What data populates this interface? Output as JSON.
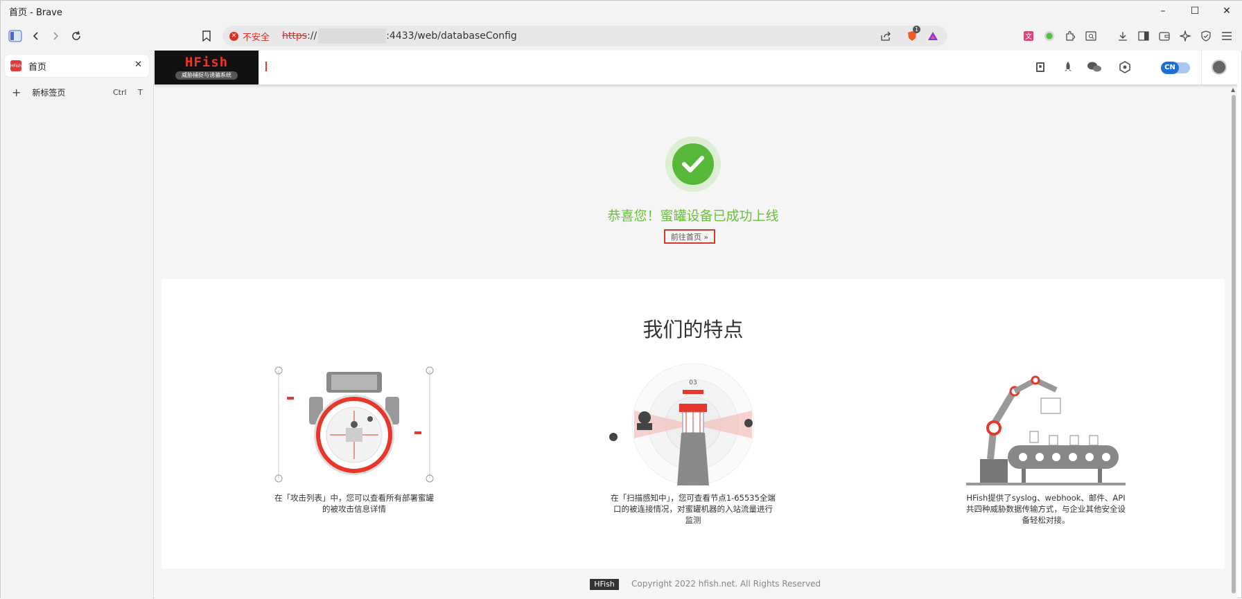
{
  "window": {
    "title": "首页 - Brave",
    "controls": [
      "–",
      "☐",
      "✕"
    ]
  },
  "toolbar": {
    "security_label": "不安全",
    "url_scheme": "https",
    "url_sep": "://",
    "url_rest": ":4433/web/databaseConfig",
    "shields_count": "1"
  },
  "tabs": {
    "active": {
      "label": "首页",
      "favicon_text": "HFish"
    },
    "new_tab": {
      "label": "新标签页",
      "key1": "Ctrl",
      "key2": "T"
    }
  },
  "hfish": {
    "logo_text": "HFish",
    "logo_subtitle": "威胁捕捉与诱骗系统",
    "lang": "CN"
  },
  "success": {
    "message": "恭喜您！蜜罐设备已成功上线",
    "home_button": "前往首页 »"
  },
  "features": {
    "title": "我们的特点",
    "items": [
      {
        "desc": "在「攻击列表」中，您可以查看所有部署蜜罐的被攻击信息详情"
      },
      {
        "desc": "在「扫描感知中」，您可查看节点1-65535全端口的被连接情况，对蜜罐机器的入站流量进行监测"
      },
      {
        "desc": "HFish提供了syslog、webhook、邮件、API共四种威胁数据传输方式，与企业其他安全设备轻松对接。"
      }
    ]
  },
  "footer": {
    "badge": "HFish",
    "copyright": "Copyright 2022 hfish.net. All Rights Reserved"
  },
  "colors": {
    "accent_red": "#e8362b",
    "success_green": "#58b83a",
    "link_red": "#d93025"
  }
}
